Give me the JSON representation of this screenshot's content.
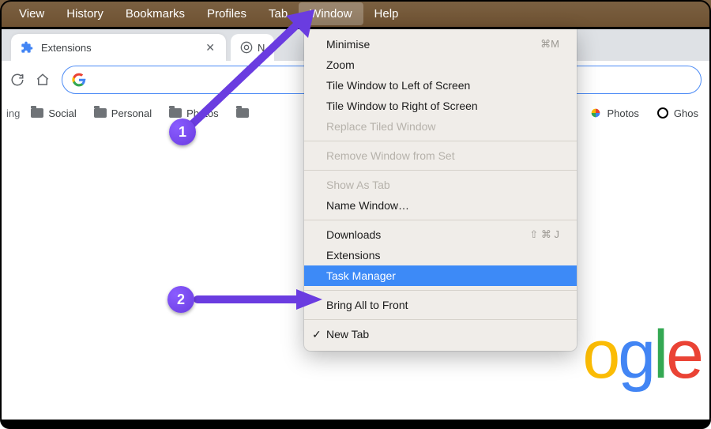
{
  "menubar": {
    "items": [
      "View",
      "History",
      "Bookmarks",
      "Profiles",
      "Tab",
      "Window",
      "Help"
    ],
    "active_index": 5
  },
  "tab": {
    "title": "Extensions",
    "next_letter": "N"
  },
  "bookmarks": {
    "left_cut": "ing",
    "items": [
      "Social",
      "Personal",
      "Photos"
    ],
    "right": [
      "Photos",
      "Ghos"
    ]
  },
  "menu": {
    "rows": [
      {
        "label": "Minimise",
        "shortcut": "⌘M"
      },
      {
        "label": "Zoom"
      },
      {
        "label": "Tile Window to Left of Screen"
      },
      {
        "label": "Tile Window to Right of Screen"
      },
      {
        "label": "Replace Tiled Window",
        "disabled": true
      },
      {
        "sep": true
      },
      {
        "label": "Remove Window from Set",
        "disabled": true
      },
      {
        "sep": true
      },
      {
        "label": "Show As Tab",
        "disabled": true
      },
      {
        "label": "Name Window…"
      },
      {
        "sep": true
      },
      {
        "label": "Downloads",
        "shortcut": "⇧ ⌘ J"
      },
      {
        "label": "Extensions"
      },
      {
        "label": "Task Manager",
        "selected": true
      },
      {
        "sep": true
      },
      {
        "label": "Bring All to Front"
      },
      {
        "sep": true
      },
      {
        "label": "New Tab",
        "checked": true
      }
    ]
  },
  "annotations": {
    "badge1": "1",
    "badge2": "2"
  }
}
